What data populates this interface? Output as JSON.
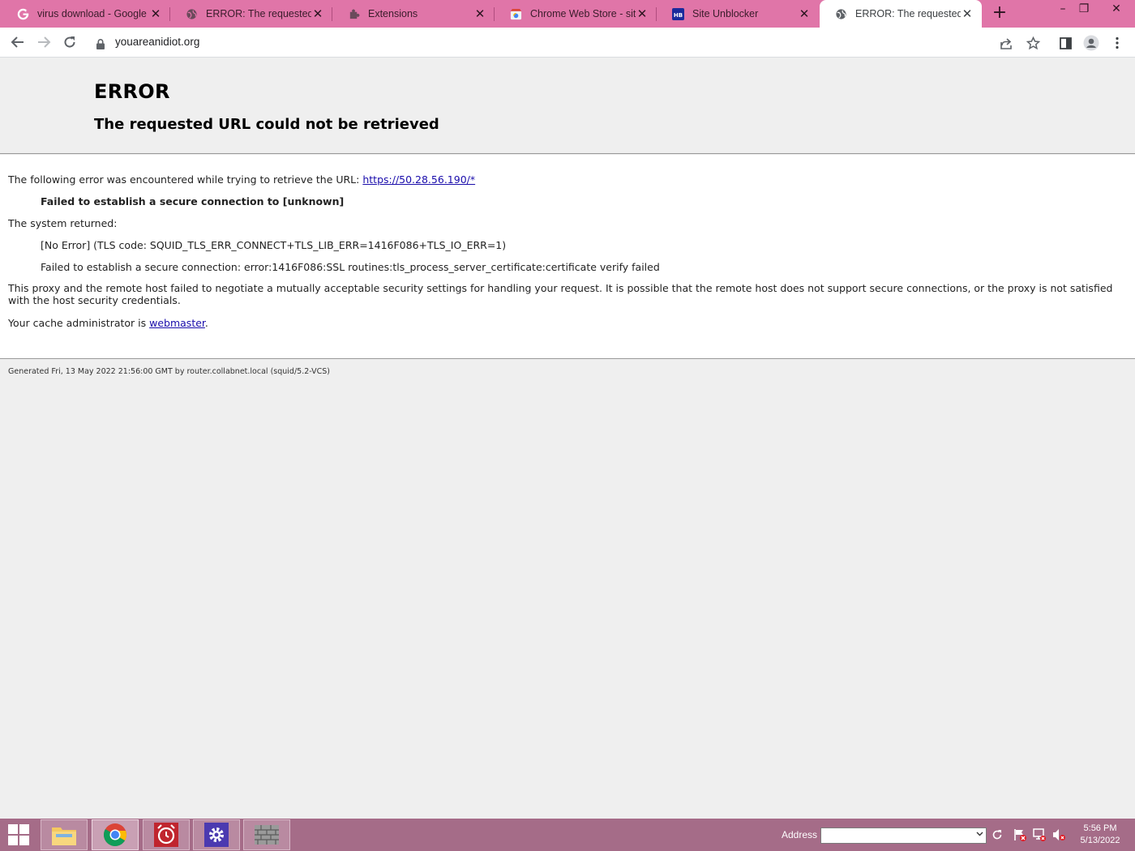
{
  "tabs": [
    {
      "title": "virus download - Google",
      "favicon": "google-icon",
      "active": false
    },
    {
      "title": "ERROR: The requested U",
      "favicon": "globe-icon",
      "active": false
    },
    {
      "title": "Extensions",
      "favicon": "puzzle-icon",
      "active": false
    },
    {
      "title": "Chrome Web Store - site",
      "favicon": "webstore-icon",
      "active": false
    },
    {
      "title": "Site Unblocker",
      "favicon": "hb-icon",
      "active": false
    },
    {
      "title": "ERROR: The requested U",
      "favicon": "globe-icon",
      "active": true
    }
  ],
  "tab_close_glyph": "✕",
  "new_tab_glyph": "+",
  "window_controls": {
    "minimize": "–",
    "restore": "❐",
    "close": "✕"
  },
  "omnibox": {
    "url": "youareanidiot.org"
  },
  "page": {
    "title": "ERROR",
    "subtitle": "The requested URL could not be retrieved",
    "intro_text": "The following error was encountered while trying to retrieve the URL: ",
    "intro_link": "https://50.28.56.190/*",
    "failure": "Failed to establish a secure connection to [unknown]",
    "system_returned": "The system returned:",
    "tls_code": "[No Error] (TLS code: SQUID_TLS_ERR_CONNECT+TLS_LIB_ERR=1416F086+TLS_IO_ERR=1)",
    "ssl_error": "Failed to establish a secure connection: error:1416F086:SSL routines:tls_process_server_certificate:certificate verify failed",
    "explanation": "This proxy and the remote host failed to negotiate a mutually acceptable security settings for handling your request. It is possible that the remote host does not support secure connections, or the proxy is not satisfied with the host security credentials.",
    "admin_text": "Your cache administrator is ",
    "admin_link": "webmaster",
    "admin_suffix": ".",
    "footer": "Generated Fri, 13 May 2022 21:56:00 GMT by router.collabnet.local (squid/5.2-VCS)"
  },
  "taskbar": {
    "address_label": "Address",
    "time": "5:56 PM",
    "date": "5/13/2022"
  },
  "colors": {
    "tabstrip": "#e075a8",
    "taskbar": "#a56c88",
    "link": "#1a0dab"
  }
}
